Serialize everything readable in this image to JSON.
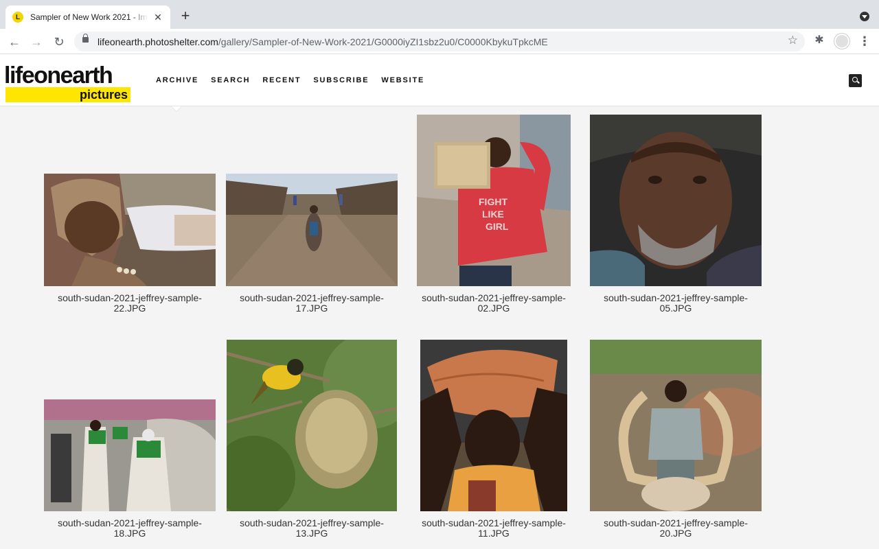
{
  "browser": {
    "tab_title": "Sampler of New Work 2021 - Im",
    "tab_favicon": "L",
    "url_host": "lifeonearth.photoshelter.com",
    "url_path": "/gallery/Sampler-of-New-Work-2021/G0000iyZI1sbz2u0/C0000KbykuTpkcME"
  },
  "site": {
    "logo_main": "lifeonearth",
    "logo_sub": "pictures",
    "brand_yellow": "#ffe600",
    "nav": [
      "ARCHIVE",
      "SEARCH",
      "RECENT",
      "SUBSCRIBE",
      "WEBSITE"
    ]
  },
  "gallery": {
    "items": [
      {
        "caption_1": "south-sudan-2021-jeffrey-sample-",
        "caption_2": "22.JPG"
      },
      {
        "caption_1": "south-sudan-2021-jeffrey-sample-",
        "caption_2": "17.JPG"
      },
      {
        "caption_1": "south-sudan-2021-jeffrey-sample-",
        "caption_2": "02.JPG"
      },
      {
        "caption_1": "south-sudan-2021-jeffrey-sample-",
        "caption_2": "05.JPG"
      },
      {
        "caption_1": "south-sudan-2021-jeffrey-sample-",
        "caption_2": "18.JPG"
      },
      {
        "caption_1": "south-sudan-2021-jeffrey-sample-",
        "caption_2": "13.JPG"
      },
      {
        "caption_1": "south-sudan-2021-jeffrey-sample-",
        "caption_2": "11.JPG"
      },
      {
        "caption_1": "south-sudan-2021-jeffrey-sample-",
        "caption_2": "20.JPG"
      }
    ]
  }
}
